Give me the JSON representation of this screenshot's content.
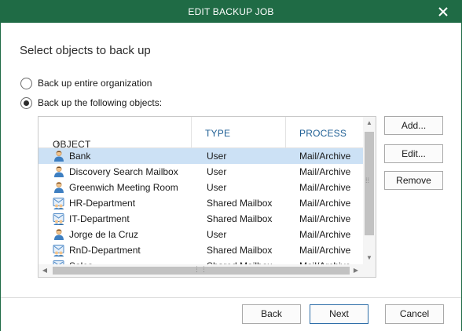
{
  "window": {
    "title": "EDIT BACKUP JOB"
  },
  "page": {
    "heading": "Select objects to back up"
  },
  "options": {
    "entire_org": "Back up entire organization",
    "following": "Back up the following objects:",
    "selected": "following"
  },
  "grid": {
    "columns": [
      "OBJECT",
      "TYPE",
      "PROCESS"
    ],
    "sort_column": "OBJECT",
    "rows": [
      {
        "object": "Bank",
        "type": "User",
        "process": "Mail/Archive",
        "icon": "user-icon",
        "selected": true
      },
      {
        "object": "Discovery Search Mailbox",
        "type": "User",
        "process": "Mail/Archive",
        "icon": "user-icon"
      },
      {
        "object": "Greenwich Meeting Room",
        "type": "User",
        "process": "Mail/Archive",
        "icon": "user-icon"
      },
      {
        "object": "HR-Department",
        "type": "Shared Mailbox",
        "process": "Mail/Archive",
        "icon": "shared-mailbox-icon"
      },
      {
        "object": "IT-Department",
        "type": "Shared Mailbox",
        "process": "Mail/Archive",
        "icon": "shared-mailbox-icon"
      },
      {
        "object": "Jorge de la Cruz",
        "type": "User",
        "process": "Mail/Archive",
        "icon": "user-icon"
      },
      {
        "object": "RnD-Department",
        "type": "Shared Mailbox",
        "process": "Mail/Archive",
        "icon": "shared-mailbox-icon"
      },
      {
        "object": "Sales",
        "type": "Shared Mailbox",
        "process": "Mail/Archive",
        "icon": "shared-mailbox-icon"
      }
    ]
  },
  "side_buttons": {
    "add": "Add...",
    "edit": "Edit...",
    "remove": "Remove"
  },
  "footer": {
    "back": "Back",
    "next": "Next",
    "cancel": "Cancel"
  },
  "colors": {
    "titlebar": "#1f6b45",
    "selection": "#cce1f5",
    "header_text": "#1f5f94"
  }
}
